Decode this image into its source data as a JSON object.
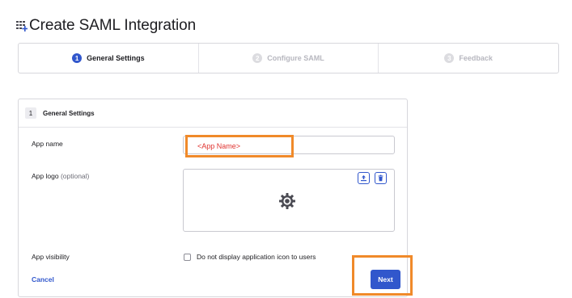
{
  "header": {
    "title": "Create SAML Integration",
    "icon": "app-grid-add-icon"
  },
  "steps": [
    {
      "num": "1",
      "label": "General Settings",
      "state": "active"
    },
    {
      "num": "2",
      "label": "Configure SAML",
      "state": "inactive"
    },
    {
      "num": "3",
      "label": "Feedback",
      "state": "inactive"
    }
  ],
  "section": {
    "num": "1",
    "title": "General Settings"
  },
  "fields": {
    "app_name_label": "App name",
    "app_name_value": "<App Name>",
    "app_logo_label": "App logo",
    "app_logo_optional": "(optional)",
    "app_visibility_label": "App visibility",
    "visibility_checkbox_label": "Do not display application icon to users"
  },
  "actions": {
    "cancel_label": "Cancel",
    "next_label": "Next"
  },
  "colors": {
    "accent": "#3157cc",
    "highlight": "#f08a2a",
    "value_text": "#e0332f",
    "border": "#d7d7dc"
  }
}
